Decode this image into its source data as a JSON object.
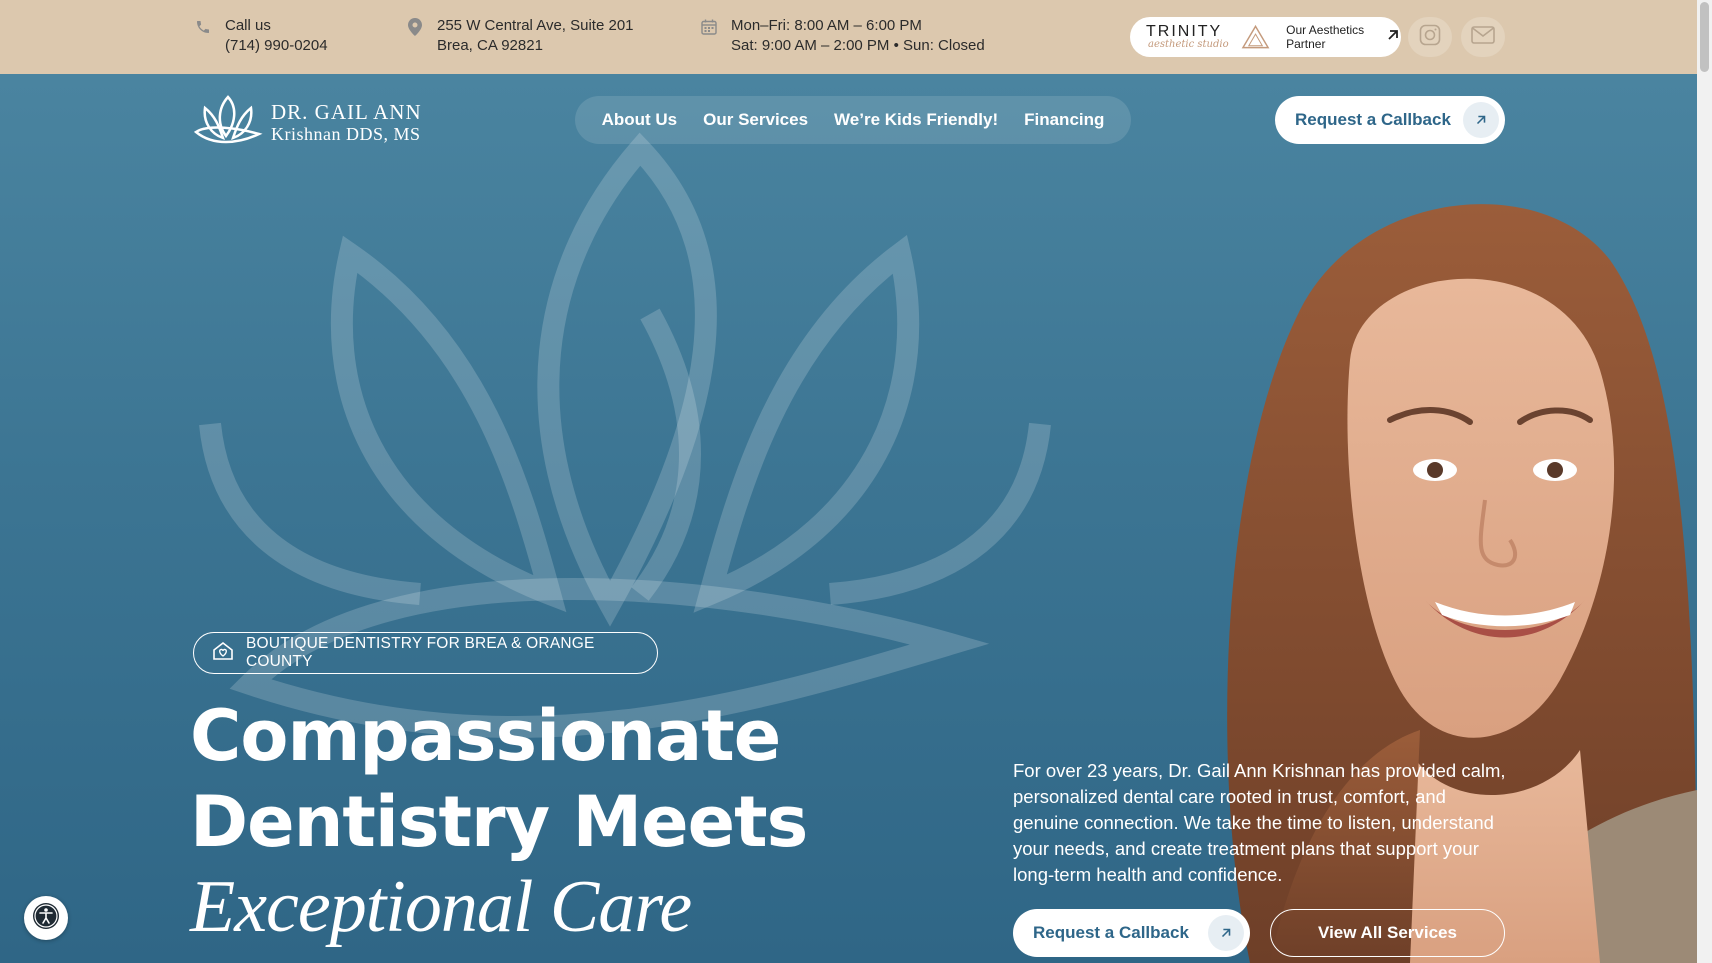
{
  "topbar": {
    "call_label": "Call us",
    "phone": "(714) 990-0204",
    "address_line1": "255 W Central Ave, Suite 201",
    "address_line2": "Brea, CA 92821",
    "hours_line1": "Mon–Fri: 8:00 AM – 6:00 PM",
    "hours_line2": "Sat: 9:00 AM – 2:00 PM • Sun: Closed",
    "partner": {
      "logo_name": "TRINITY",
      "logo_sub": "aesthetic studio",
      "label_line1": "Our Aesthetics",
      "label_line2": "Partner"
    }
  },
  "header": {
    "logo_line1": "DR. GAIL ANN",
    "logo_line2": "Krishnan DDS, MS",
    "nav": [
      {
        "label": "About Us"
      },
      {
        "label": "Our Services"
      },
      {
        "label": "We’re Kids Friendly!"
      },
      {
        "label": "Financing"
      }
    ],
    "cta_label": "Request a Callback"
  },
  "hero": {
    "badge": "BOUTIQUE DENTISTRY FOR BREA & ORANGE COUNTY",
    "title_line1": "Compassionate",
    "title_line2": "Dentistry Meets",
    "title_line3": "Exceptional Care",
    "description": "For over 23 years, Dr. Gail Ann Krishnan has provided calm, personalized dental care rooted in trust, comfort, and genuine connection. We take the time to listen, understand your needs, and create treatment plans that support your long-term health and confidence.",
    "cta_primary": "Request a Callback",
    "cta_secondary": "View All Services"
  },
  "colors": {
    "topbar_bg": "#dcc8ae",
    "hero_bg": "#3e7896",
    "accent_text": "#2e6689"
  },
  "icons": [
    "phone-icon",
    "location-pin-icon",
    "calendar-icon",
    "arrow-up-right-icon",
    "instagram-icon",
    "mail-icon",
    "home-heart-icon",
    "accessibility-icon",
    "lotus-logo-icon"
  ]
}
